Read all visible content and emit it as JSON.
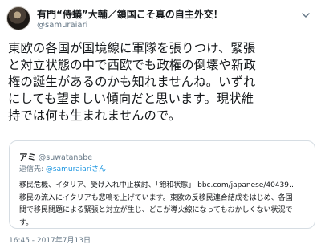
{
  "tweet": {
    "display_name": "有門“侍蟻”大輔／鎖国こそ真の自主外交！",
    "username": "@samuraiari",
    "lines": [
      "東欧の各国が国境線に軍隊を張りつけ、緊張",
      "と対立状態の中で西欧でも政権の倒壊や新政",
      "権の誕生があるのかも知れませんね。いずれ",
      "にしても望ましい傾向だと思います。現状維",
      "持では何も生まれませんので。"
    ],
    "timestamp": "16:45 - 2017年7月13日"
  },
  "quote": {
    "name": "アミ",
    "handle": "@suwatanabe",
    "reply_prefix": "返信先: ",
    "reply_mention": "@samuraiariさん",
    "line1_text": "移民危機、イタリア、受け入れ中止検討、「飽和状態」",
    "line1_link": "bbc.com/japanese/40439…",
    "line2": "移民の流入にイタリアも悲鳴を上げています。東欧の反移民連合結成をはじめ、各国",
    "line3": "間で移民問題による緊張と対立が生じ、どこが導火線になってもおかしくない状況で",
    "line4": "す。"
  },
  "colors": {
    "text": "#14171a",
    "secondary": "#657786",
    "link": "#1b95e0",
    "border": "#d6dde3"
  }
}
